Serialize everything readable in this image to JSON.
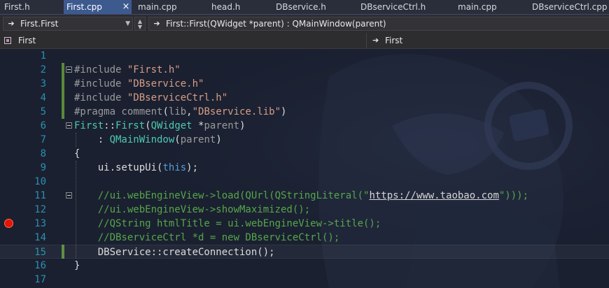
{
  "tabs": [
    {
      "label": "First.h"
    },
    {
      "label": "First.cpp",
      "active": true
    },
    {
      "label": "main.cpp"
    },
    {
      "label": "head.h"
    },
    {
      "label": "DBservice.h"
    },
    {
      "label": "DBserviceCtrl.h"
    },
    {
      "label": "main.cpp"
    },
    {
      "label": "DBserviceCtrl.cpp"
    }
  ],
  "tab_close_glyph": "×",
  "nav": {
    "scope_combo": "First.First",
    "member_combo": "First::First(QWidget *parent) : QMainWindow(parent)",
    "project_box": "First",
    "function_box": "First"
  },
  "editor": {
    "line_numbers": [
      "1",
      "2",
      "3",
      "4",
      "5",
      "6",
      "7",
      "8",
      "9",
      "10",
      "11",
      "12",
      "13",
      "14",
      "15",
      "16",
      "17"
    ],
    "current_line": 15,
    "breakpoint_line": 13,
    "lines": [
      {
        "n": 1,
        "tokens": []
      },
      {
        "n": 2,
        "tokens": [
          [
            "pre",
            "#include "
          ],
          [
            "str",
            "\"First.h\""
          ]
        ]
      },
      {
        "n": 3,
        "tokens": [
          [
            "pre",
            "#include "
          ],
          [
            "str",
            "\"DBservice.h\""
          ]
        ]
      },
      {
        "n": 4,
        "tokens": [
          [
            "pre",
            "#include "
          ],
          [
            "str",
            "\"DBserviceCtrl.h\""
          ]
        ]
      },
      {
        "n": 5,
        "tokens": [
          [
            "pre",
            "#pragma comment"
          ],
          [
            "plain",
            "("
          ],
          [
            "pre",
            "lib"
          ],
          [
            "plain",
            ","
          ],
          [
            "str",
            "\"DBservice.lib\""
          ],
          [
            "plain",
            ")"
          ]
        ]
      },
      {
        "n": 6,
        "tokens": [
          [
            "type",
            "First"
          ],
          [
            "plain",
            "::"
          ],
          [
            "type",
            "First"
          ],
          [
            "plain",
            "("
          ],
          [
            "type",
            "QWidget"
          ],
          [
            "plain",
            " *"
          ],
          [
            "param",
            "parent"
          ],
          [
            "plain",
            ")"
          ]
        ]
      },
      {
        "n": 7,
        "tokens": [
          [
            "plain",
            "    : "
          ],
          [
            "type",
            "QMainWindow"
          ],
          [
            "plain",
            "("
          ],
          [
            "param",
            "parent"
          ],
          [
            "plain",
            ")"
          ]
        ]
      },
      {
        "n": 8,
        "tokens": [
          [
            "plain",
            "{"
          ]
        ]
      },
      {
        "n": 9,
        "tokens": [
          [
            "plain",
            "    ui.setupUi("
          ],
          [
            "kw",
            "this"
          ],
          [
            "plain",
            ");"
          ]
        ]
      },
      {
        "n": 10,
        "tokens": []
      },
      {
        "n": 11,
        "tokens": [
          [
            "com",
            "    //ui.webEngineView->load(QUrl(QStringLiteral(\""
          ],
          [
            "url",
            "https://www.taobao.com"
          ],
          [
            "com",
            "\")));"
          ]
        ]
      },
      {
        "n": 12,
        "tokens": [
          [
            "com",
            "    //ui.webEngineView->showMaximized();"
          ]
        ]
      },
      {
        "n": 13,
        "tokens": [
          [
            "com",
            "    //QString htmlTitle = ui.webEngineView->title();"
          ]
        ]
      },
      {
        "n": 14,
        "tokens": [
          [
            "com",
            "    //DBserviceCtrl *d = new DBserviceCtrl();"
          ]
        ]
      },
      {
        "n": 15,
        "tokens": [
          [
            "plain",
            "    DBService::createConnection();"
          ]
        ]
      },
      {
        "n": 16,
        "tokens": [
          [
            "plain",
            "}"
          ]
        ]
      },
      {
        "n": 17,
        "tokens": []
      }
    ]
  },
  "colors": {
    "line_number": "#2b91af",
    "preprocessor": "#9b9b9b",
    "string": "#d69d85",
    "type": "#4ec9b0",
    "keyword": "#569cd6",
    "comment": "#57a64a",
    "change_bar": "#5a8a3a",
    "breakpoint": "#e51400",
    "active_tab": "#3d5a8f"
  },
  "icons": {
    "scope_icon": "arrow-right-icon",
    "member_icon": "arrow-right-icon",
    "project_icon": "class-icon",
    "function_icon": "arrow-right-icon",
    "dropdown_icon": "chevron-down-icon",
    "breakpoint_icon": "breakpoint-icon"
  }
}
